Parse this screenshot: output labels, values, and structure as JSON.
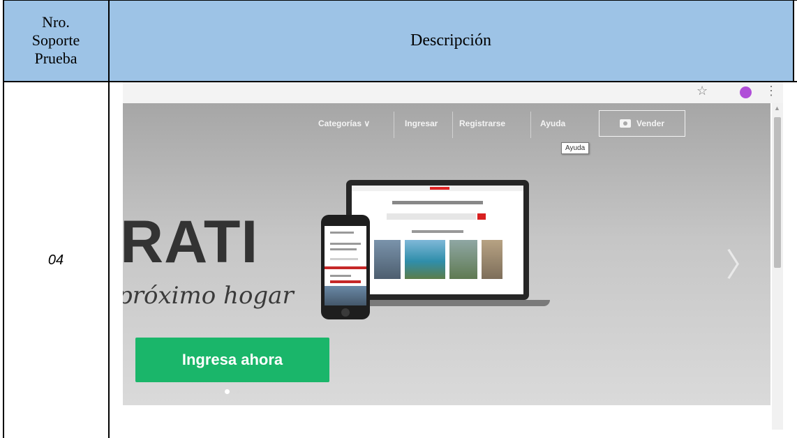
{
  "table": {
    "header_left_lines": [
      "Nro.",
      "Soporte",
      "Prueba"
    ],
    "header_right": "Descripción",
    "row_id": "04"
  },
  "colors": {
    "header_bg": "#9dc3e6",
    "cta_green": "#1ab66a",
    "accent_red": "#d82020",
    "profile_purple": "#b04ed8"
  },
  "screenshot": {
    "browser": {
      "icons": [
        "star-icon",
        "menu-dots-icon"
      ]
    },
    "nav": {
      "categorias": "Categorías ∨",
      "ingresar": "Ingresar",
      "registrarse": "Registrarse",
      "ayuda": "Ayuda",
      "vender": "Vender"
    },
    "tooltip": "Ayuda",
    "hero": {
      "headline": "RATI",
      "subtitle": "próximo hogar",
      "cta": "Ingresa ahora",
      "carousel_active_index": 1,
      "carousel_count": 2
    }
  }
}
